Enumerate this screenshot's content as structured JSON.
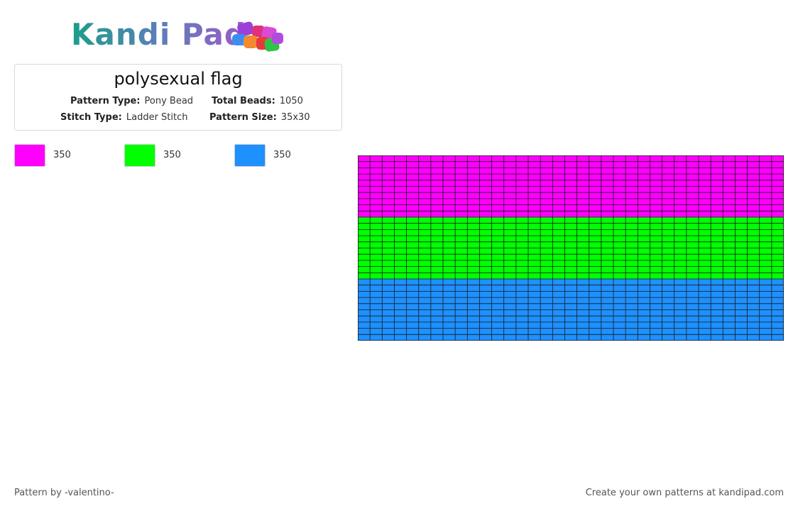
{
  "logo": {
    "text": "Kandi Pad",
    "icon": "bead-pile-icon"
  },
  "pattern": {
    "title": "polysexual flag",
    "pattern_type_label": "Pattern Type:",
    "pattern_type": "Pony Bead",
    "total_beads_label": "Total Beads:",
    "total_beads": "1050",
    "stitch_type_label": "Stitch Type:",
    "stitch_type": "Ladder Stitch",
    "pattern_size_label": "Pattern Size:",
    "pattern_size": "35x30"
  },
  "legend": [
    {
      "color": "#ff00ff",
      "count": "350"
    },
    {
      "color": "#00ff00",
      "count": "350"
    },
    {
      "color": "#1e90ff",
      "count": "350"
    }
  ],
  "grid": {
    "columns": 35,
    "rows": 30,
    "bands": [
      {
        "color": "#ff00ff",
        "rows": 10
      },
      {
        "color": "#00ff00",
        "rows": 10
      },
      {
        "color": "#1e90ff",
        "rows": 10
      }
    ],
    "line_color": "#1a1a1a"
  },
  "footer": {
    "author": "Pattern by -valentino-",
    "promo": "Create your own patterns at kandipad.com"
  }
}
